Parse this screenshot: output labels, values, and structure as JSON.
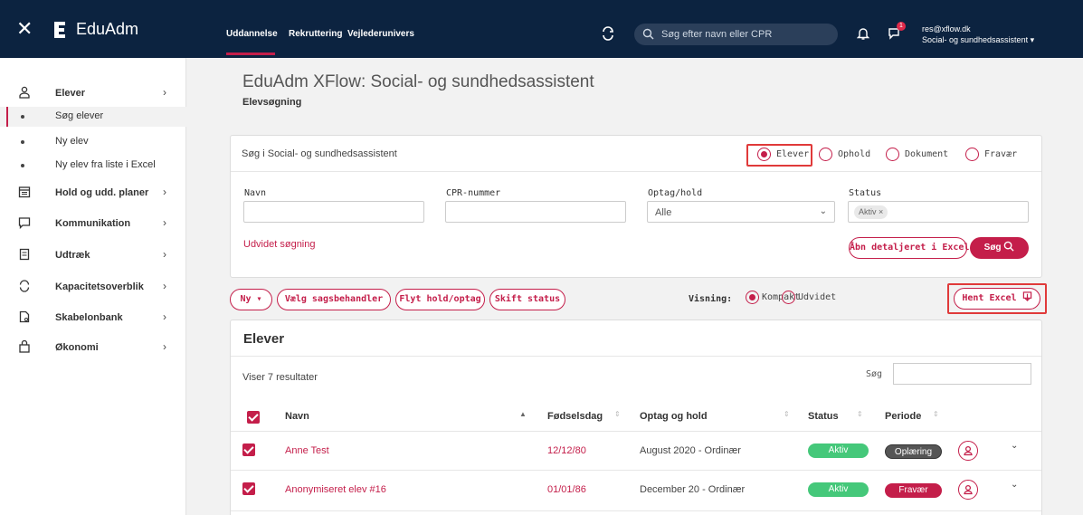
{
  "topbar": {
    "logo": "EduAdm",
    "tabs": [
      "Uddannelse",
      "Rekruttering",
      "Vejlederunivers"
    ],
    "search_placeholder": "Søg efter navn eller CPR",
    "notification_count": "1",
    "user_email": "res@xflow.dk",
    "user_role": "Social- og sundhedsassistent"
  },
  "sidebar": {
    "elever": "Elever",
    "sub_items": [
      "Søg elever",
      "Ny elev",
      "Ny elev fra liste i Excel"
    ],
    "items": [
      "Hold og udd. planer",
      "Kommunikation",
      "Udtræk",
      "Kapacitetsoverblik",
      "Skabelonbank",
      "Økonomi"
    ]
  },
  "page": {
    "title": "EduAdm XFlow: Social- og sundhedsassistent",
    "subtitle": "Elevsøgning"
  },
  "search_panel": {
    "title": "Søg i Social- og sundhedsassistent",
    "radios": [
      "Elever",
      "Ophold",
      "Dokument",
      "Fravær"
    ],
    "fields": {
      "name_label": "Navn",
      "cpr_label": "CPR-nummer",
      "optag_label": "Optag/hold",
      "optag_value": "Alle",
      "status_label": "Status",
      "status_tag": "Aktiv ×"
    },
    "advanced_link": "Udvidet søgning",
    "excel_button": "Åbn detaljeret i Excel",
    "search_button": "Søg"
  },
  "toolbar": {
    "ny": "Ny ▾",
    "case_worker": "Vælg sagsbehandler",
    "move": "Flyt hold/optag",
    "change_status": "Skift status",
    "view_label": "Visning:",
    "view_compact": "Kompakt",
    "view_extended": "Udvidet",
    "get_excel": "Hent Excel"
  },
  "results": {
    "title": "Elever",
    "count": "Viser 7 resultater",
    "search_label": "Søg",
    "columns": [
      "Navn",
      "Fødselsdag",
      "Optag og hold",
      "Status",
      "Periode"
    ],
    "rows": [
      {
        "name": "Anne Test",
        "birthday": "12/12/80",
        "optag": "August 2020 - Ordinær",
        "status": "Aktiv",
        "periode": "Oplæring"
      },
      {
        "name": "Anonymiseret elev #16",
        "birthday": "01/01/86",
        "optag": "December 20 - Ordinær",
        "status": "Aktiv",
        "periode": "Fravær"
      }
    ]
  },
  "colors": {
    "navy": "#0c2340",
    "accent": "#c41e4a",
    "green": "#45c87a",
    "highlight": "#e03a3a"
  }
}
